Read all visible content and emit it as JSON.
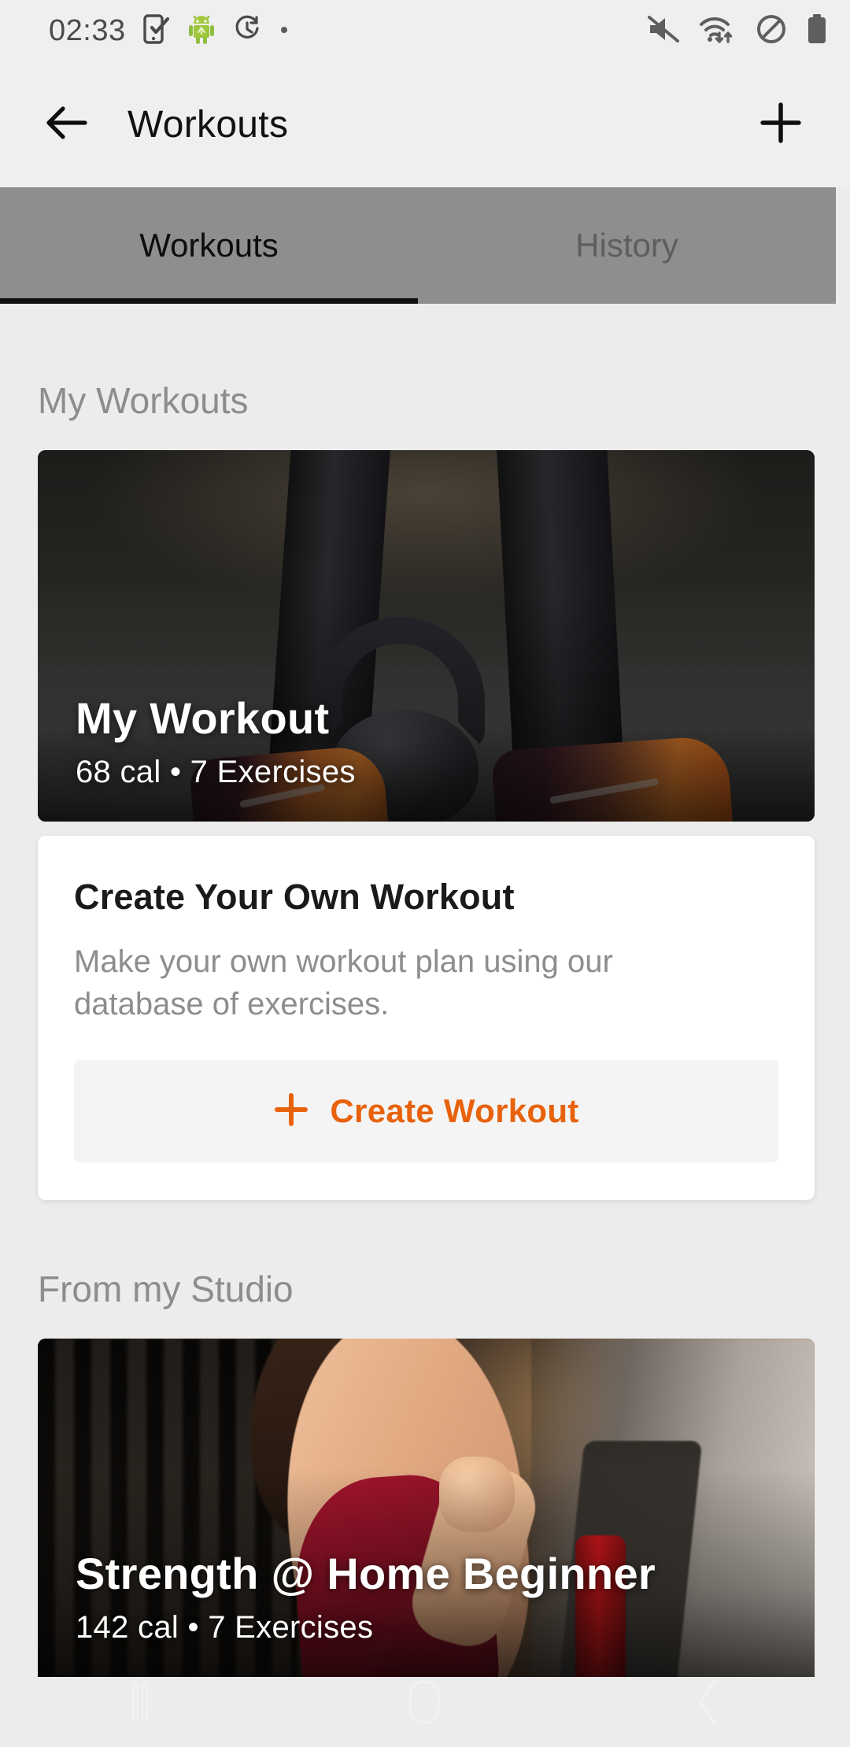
{
  "statusbar": {
    "time": "02:33",
    "left_icons": [
      "phone-check-icon",
      "android-robot-icon",
      "history-clock-icon",
      "notification-dot-icon"
    ],
    "right_icons": [
      "mute-icon",
      "wifi-data-icon",
      "do-not-disturb-icon",
      "battery-icon"
    ]
  },
  "appbar": {
    "back_icon": "back-arrow-icon",
    "title": "Workouts",
    "add_icon": "plus-icon"
  },
  "tabs": [
    {
      "label": "Workouts",
      "active": true
    },
    {
      "label": "History",
      "active": false
    }
  ],
  "sections": {
    "my_workouts": {
      "title": "My Workouts",
      "card": {
        "title": "My Workout",
        "subtitle": "68 cal • 7 Exercises",
        "calories": "68 cal",
        "exercises": "7 Exercises",
        "image": "kettlebell-sneakers-photo"
      },
      "create_card": {
        "title": "Create Your Own Workout",
        "description": "Make your own workout plan using our database of exercises.",
        "button_label": "Create Workout",
        "button_icon": "plus-icon"
      }
    },
    "from_my_studio": {
      "title": "From my Studio",
      "card": {
        "title": "Strength @ Home Beginner",
        "subtitle": "142 cal • 7 Exercises",
        "calories": "142 cal",
        "exercises": "7 Exercises",
        "image": "gym-treadmill-woman-photo"
      }
    }
  },
  "navbar": {
    "recents_icon": "recents-icon",
    "home_icon": "home-icon",
    "back_icon": "nav-back-icon"
  },
  "colors": {
    "accent_orange": "#e8620c",
    "page_background": "#ececec",
    "tab_background": "#8e8e8e",
    "card_white": "#ffffff",
    "muted_text": "#8d8d8d"
  }
}
